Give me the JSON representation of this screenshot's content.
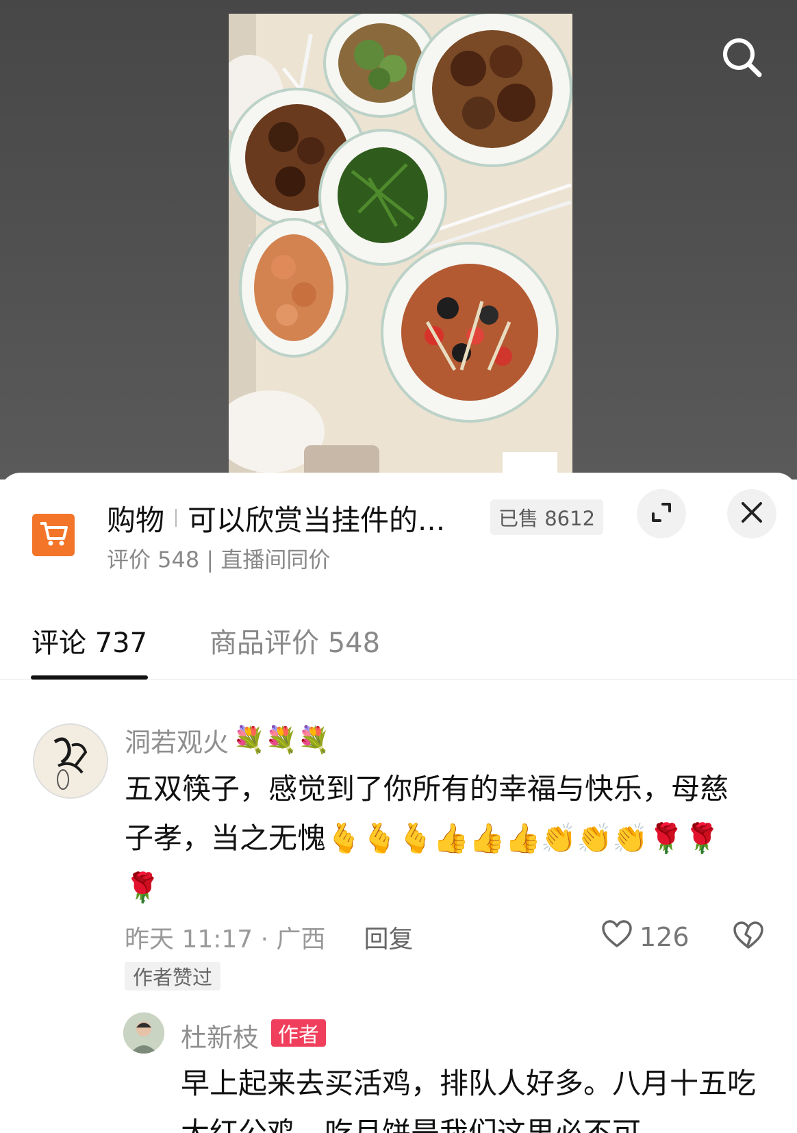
{
  "icons": {
    "search": "search-icon",
    "cart": "shopping-cart-icon",
    "expand": "expand-icon",
    "close": "close-icon",
    "like": "heart-outline-icon",
    "dislike": "broken-heart-icon"
  },
  "colors": {
    "cart_bg": "#f37529",
    "author_tag_bg": "#f03f5c",
    "tab_active": "#111111",
    "muted_text": "#8f8f8f"
  },
  "shop": {
    "category": "购物",
    "title": "可以欣赏当挂件的...",
    "sold": "已售 8612",
    "subtitle": "评价 548 | 直播间同价"
  },
  "tabs": [
    {
      "label": "评论 737",
      "active": true
    },
    {
      "label": "商品评价 548",
      "active": false
    }
  ],
  "comment": {
    "username": "洞若观火",
    "username_emoji": "💐💐💐",
    "text": "五双筷子，感觉到了你所有的幸福与快乐，母慈子孝，当之无愧🫰🫰🫰👍👍👍👏👏👏🌹🌹🌹",
    "time_location": "昨天 11:17 · 广西",
    "reply_label": "回复",
    "likes": "126",
    "author_liked": "作者赞过"
  },
  "reply": {
    "username": "杜新枝",
    "author_tag": "作者",
    "text": "早上起来去买活鸡，排队人好多。八月十五吃大红公鸡，吃月饼是我们这里必不可"
  }
}
